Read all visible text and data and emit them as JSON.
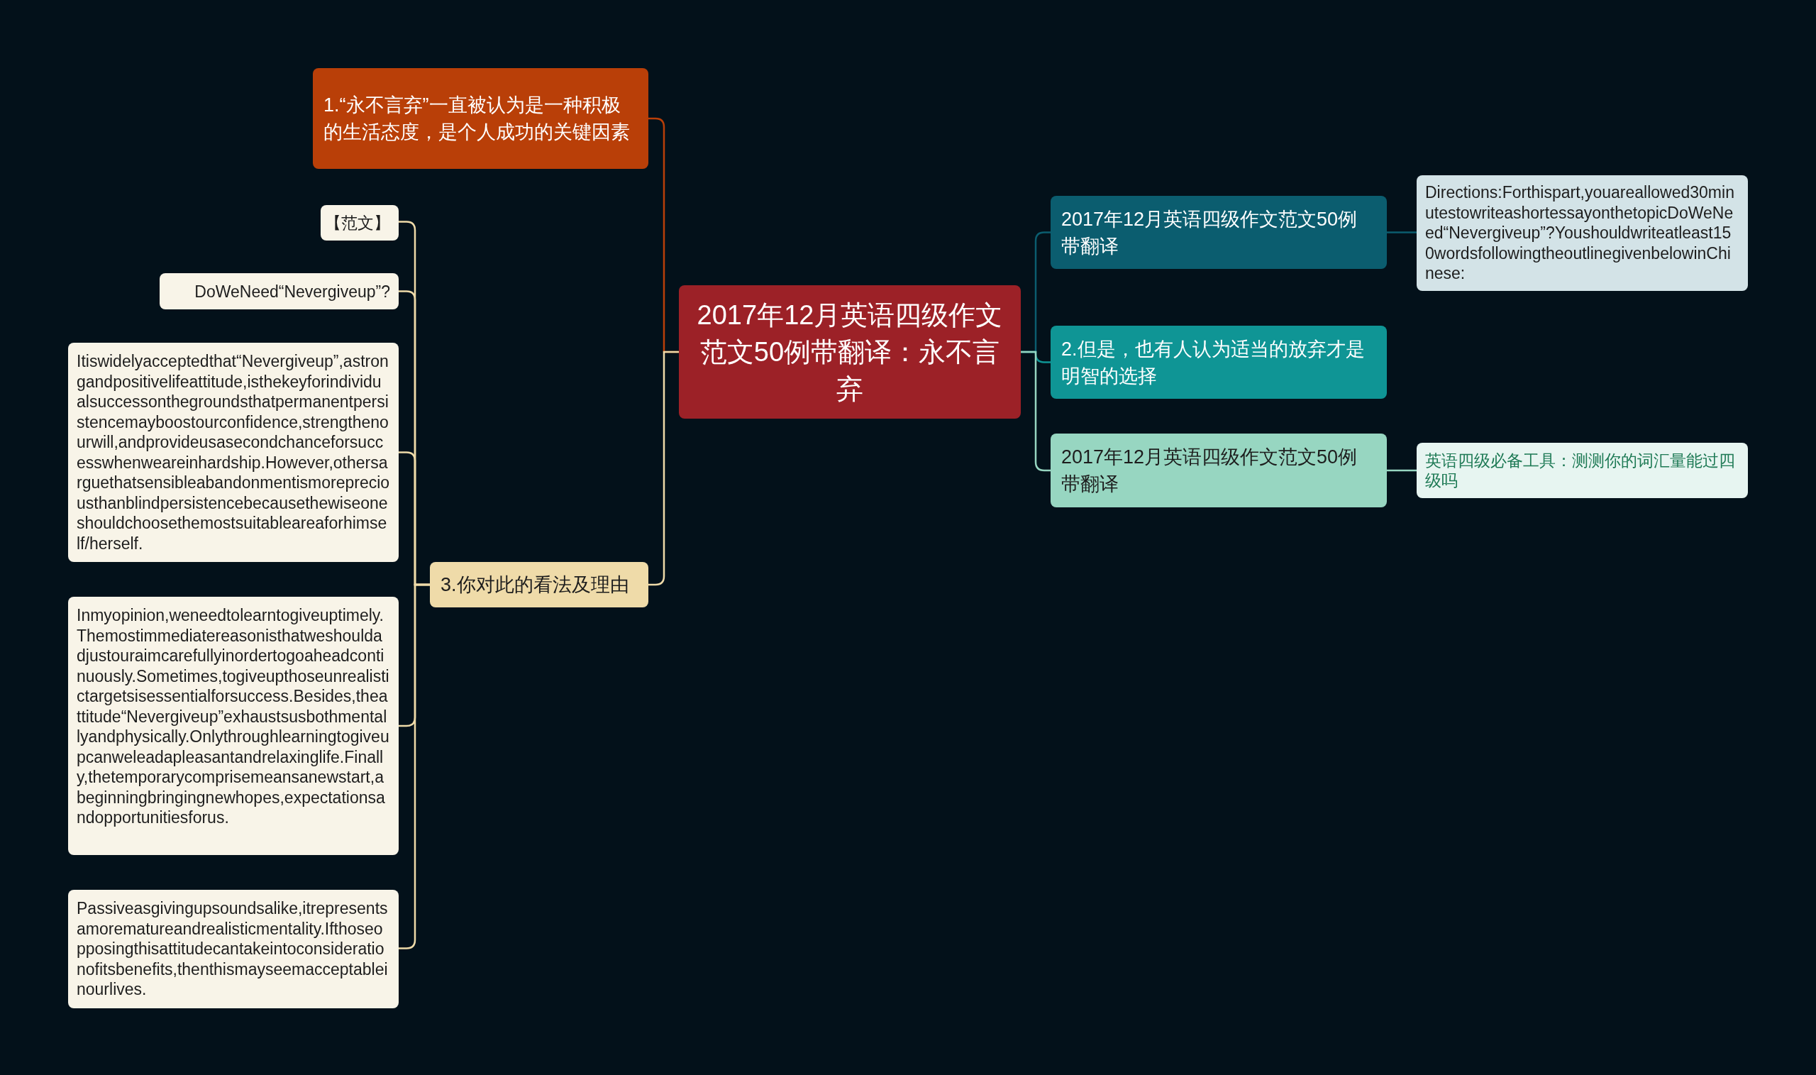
{
  "root": {
    "text": "2017年12月英语四级作文范文50例带翻译：永不言弃",
    "color": "#9c2127"
  },
  "left_branches": [
    {
      "text": "1.“永不言弃”一直被认为是一种积极的生活态度，是个人成功的关键因素",
      "color": "#b93f08"
    },
    {
      "text": "3.你对此的看法及理由",
      "color": "#efdba9",
      "children": [
        {
          "text": "【范文】"
        },
        {
          "text": "DoWeNeed“Nevergiveup”?"
        },
        {
          "text": "Itiswidelyacceptedthat“Nevergiveup”,astrongandpositivelifeattitude,isthekeyforindividualsuccessonthegroundsthatpermanentpersistencemayboostourconfidence,strengthenourwill,andprovideusasecondchanceforsuccesswhenweareinhardship.However,othersarguethatsensibleabandonmentismorepreciousthanblindpersistencebecausethewiseoneshouldchoosethemostsuitableareaforhimself/herself."
        },
        {
          "text": "Inmyopinion,weneedtolearntogiveuptimely.Themostimmediatereasonisthatweshouldadjustouraimcarefullyinordertogoaheadcontinuously.Sometimes,togiveupthoseunrealistictargetsisessentialforsuccess.Besides,theattitude“Nevergiveup”exhaustsusbothmentallyandphysically.Onlythroughlearningtogiveupcanweleadapleasantandrelaxinglife.Finally,thetemporarycomprisemeansanewstart,abeginningbringingnewhopes,expectationsandopportunitiesforus."
        },
        {
          "text": "Passiveasgivingupsoundsalike,itrepresentsamorematureandrealisticmentality.Ifthoseopposingthisattitudecantakeintoconsiderationofitsbenefits,thenthismayseemacceptableinourlives."
        }
      ]
    }
  ],
  "right_branches": [
    {
      "text": "2017年12月英语四级作文范文50例带翻译",
      "color": "#0b5d6f",
      "children": [
        {
          "text": "Directions:Forthispart,youareallowed30minutestowriteashortessayonthetopicDoWeNeed“Nevergiveup”?Youshouldwriteatleast150wordsfollowingtheoutlinegivenbelowinChinese:",
          "color": "#d3e3e7"
        }
      ]
    },
    {
      "text": "2.但是，也有人认为适当的放弃才是明智的选择",
      "color": "#0f9595"
    },
    {
      "text": "2017年12月英语四级作文范文50例带翻译",
      "color": "#97d6c1",
      "children": [
        {
          "text": "英语四级必备工具：测测你的词汇量能过四级吗",
          "color": "#e7f5f1"
        }
      ]
    }
  ]
}
